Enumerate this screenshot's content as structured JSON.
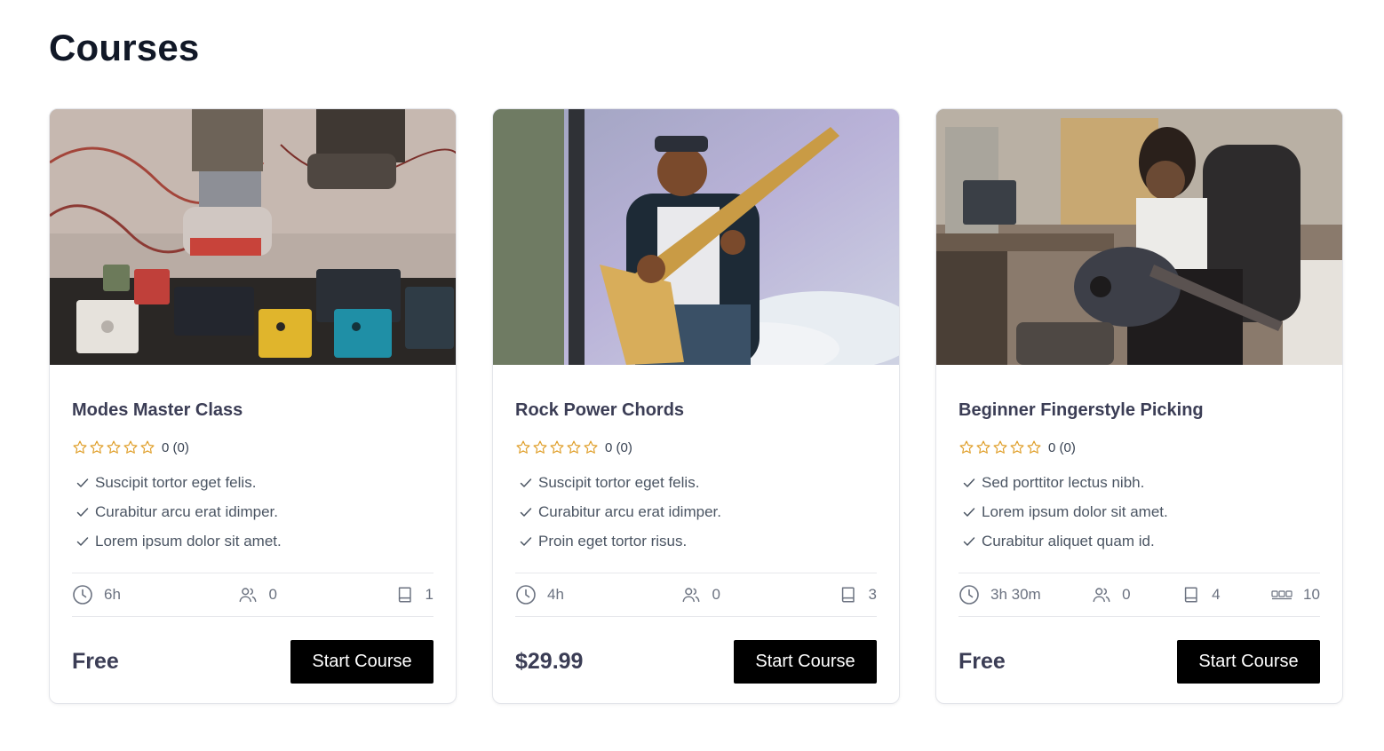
{
  "page": {
    "title": "Courses"
  },
  "colors": {
    "star": "#e0a02c",
    "button_bg": "#000000",
    "title_text": "#3b3d55"
  },
  "cards": [
    {
      "title": "Modes Master Class",
      "rating_text": "0 (0)",
      "features": [
        "Suscipit tortor eget felis.",
        "Curabitur arcu erat idimper.",
        "Lorem ipsum dolor sit amet."
      ],
      "meta": {
        "duration": "6h",
        "students": "0",
        "lessons": "1"
      },
      "price": "Free",
      "button_label": "Start Course",
      "image": "guitar-pedalboard-photo"
    },
    {
      "title": "Rock Power Chords",
      "rating_text": "0 (0)",
      "features": [
        "Suscipit tortor eget felis.",
        "Curabitur arcu erat idimper.",
        "Proin eget tortor risus."
      ],
      "meta": {
        "duration": "4h",
        "students": "0",
        "lessons": "3"
      },
      "price": "$29.99",
      "button_label": "Start Course",
      "image": "rock-guitarist-stage-photo"
    },
    {
      "title": "Beginner Fingerstyle Picking",
      "rating_text": "0 (0)",
      "features": [
        "Sed porttitor lectus nibh.",
        "Lorem ipsum dolor sit amet.",
        "Curabitur aliquet quam id."
      ],
      "meta": {
        "duration": "3h 30m",
        "students": "0",
        "lessons": "4",
        "seats": "10"
      },
      "price": "Free",
      "button_label": "Start Course",
      "image": "acoustic-guitarist-room-photo"
    }
  ],
  "icons": {
    "star": "star-outline-icon",
    "check": "check-icon",
    "duration": "clock-icon",
    "students": "users-icon",
    "lessons": "book-icon",
    "seats": "seats-icon"
  }
}
